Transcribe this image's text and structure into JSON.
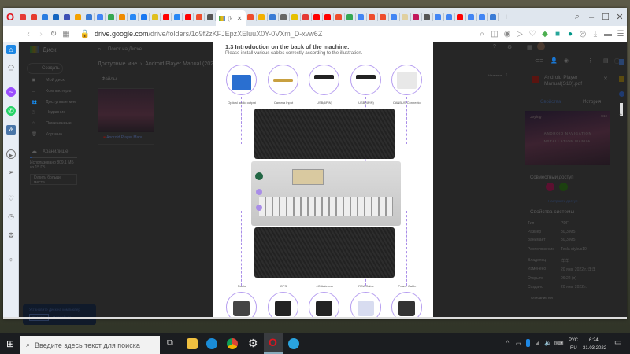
{
  "browser": {
    "active_tab_label": "(k",
    "tab_icon_colors": [
      "#e53935",
      "#e63b2e",
      "#2a7de1",
      "#1565c0",
      "#3f51b5",
      "#f4a100",
      "#3a7bd5",
      "#4285f4",
      "#34a853",
      "#ef8b00",
      "#2787f5",
      "#1877f2",
      "#e0c020",
      "#ff0000",
      "#2787f5",
      "#ff0000",
      "#ee4d2d",
      "#555555"
    ],
    "tab_icon_colors_right": [
      "#ee4d2d",
      "#f2b000",
      "#3a7bd5",
      "#666666",
      "#e6c000",
      "#e53935",
      "#ff0000",
      "#ff0000",
      "#ee4d2d",
      "#34a853",
      "#4285f4",
      "#ee4d2d",
      "#ee4d2d",
      "#4285f4",
      "#e0d0a0",
      "#c2185b",
      "#555555",
      "#4285f4",
      "#4285f4",
      "#ff0000",
      "#4285f4",
      "#4285f4",
      "#3a7bd5"
    ],
    "url_host": "drive.google.com",
    "url_path": "/drive/folders/1o9f2zKFJEpzXEluuX0Y-0VXm_D-xvw6Z"
  },
  "drive": {
    "logo_label": "Диск",
    "search_placeholder": "Поиск на Диске",
    "create_label": "Создать",
    "nav": [
      "Мой диск",
      "Компьютеры",
      "Доступные мне",
      "Недавние",
      "Помеченные",
      "Корзина"
    ],
    "storage_label": "Хранилище",
    "storage_used": "Использовано 809,1 МБ из 15 ГБ",
    "storage_fraction": 0.05,
    "buy_storage": "Купить больше места",
    "breadcrumb": [
      "Доступные мне",
      "Android Player Manual  (2022)"
    ],
    "files_header": "Файлы",
    "sort_label": "Название",
    "file_name": "Android Player Manu...",
    "banner": {
      "title": "Установите Диск на компьютер",
      "download": "Скачать",
      "more": "Подробнее..."
    }
  },
  "cover": {
    "brand": "Joying",
    "model": "S10",
    "title": "ANDROID NAVIGATION INSTALLATION MANUAL"
  },
  "pdf": {
    "heading": "1.3 Introduction on the back of the machine:",
    "subheading": "Please install various cables correctly according to the illustration.",
    "top_labels": [
      "Optical audio output",
      "Camera Input",
      "USB(6PIN)",
      "USB(4PIN)",
      "CANBUS Connector"
    ],
    "bottom_labels": [
      "Radio",
      "GPS",
      "4G Antenna",
      "RCA Cable",
      "Power Cable"
    ]
  },
  "details": {
    "file_title": "Android Player Manual(S10).pdf",
    "tabs": [
      "Свойства",
      "История"
    ],
    "sharing_header": "Совместный доступ",
    "manage_access": "Настроить доступ",
    "system_header": "Свойства системы",
    "props": [
      [
        "Тип",
        "PDF"
      ],
      [
        "Размер",
        "30,3 МБ"
      ],
      [
        "Занимает",
        "30,3 МБ"
      ],
      [
        "Расположение",
        "Tesla style/s10"
      ],
      [
        "Владелец",
        "洋洋"
      ],
      [
        "Изменено",
        "20 янв. 2022 г. 洋洋"
      ],
      [
        "Открыто",
        "06:22 (я)"
      ],
      [
        "Создано",
        "20 янв. 2022 г."
      ]
    ],
    "description": "Описание нет"
  },
  "taskbar": {
    "search_placeholder": "Введите здесь текст для поиска",
    "lang_top": "РУС",
    "lang_bottom": "RU",
    "time": "6:24",
    "date": "31.03.2022"
  }
}
